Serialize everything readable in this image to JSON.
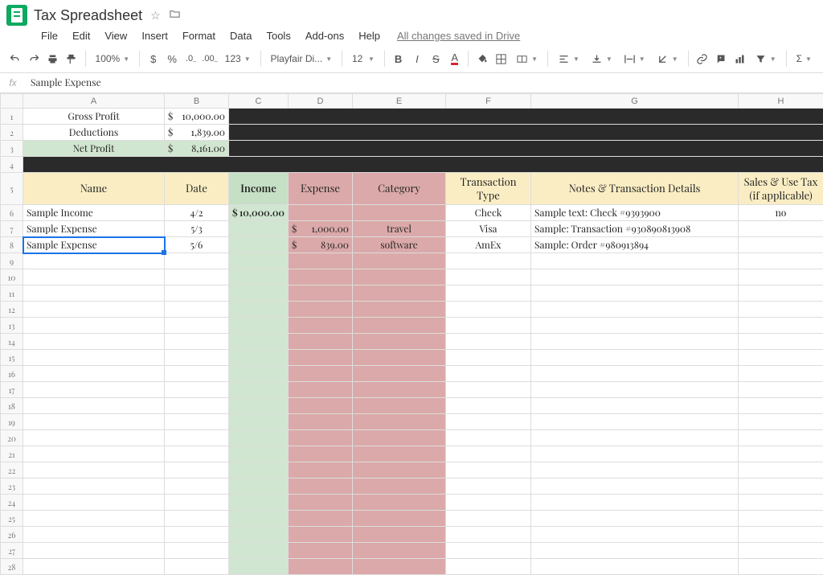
{
  "doc": {
    "title": "Tax Spreadsheet"
  },
  "menu": {
    "file": "File",
    "edit": "Edit",
    "view": "View",
    "insert": "Insert",
    "format": "Format",
    "data": "Data",
    "tools": "Tools",
    "addons": "Add-ons",
    "help": "Help",
    "save": "All changes saved in Drive"
  },
  "toolbar": {
    "zoom": "100%",
    "font": "Playfair Di...",
    "size": "12",
    "numfmt": "123"
  },
  "fx": {
    "label": "fx",
    "value": "Sample Expense"
  },
  "columns": [
    "A",
    "B",
    "C",
    "D",
    "E",
    "F",
    "G",
    "H"
  ],
  "summary": {
    "gross_label": "Gross Profit",
    "gross_val": "10,000.00",
    "ded_label": "Deductions",
    "ded_val": "1,839.00",
    "net_label": "Net Profit",
    "net_val": "8,161.00"
  },
  "headers": {
    "name": "Name",
    "date": "Date",
    "income": "Income",
    "expense": "Expense",
    "category": "Category",
    "txn": "Transaction Type",
    "notes": "Notes & Transaction Details",
    "tax": "Sales & Use Tax (if applicable)"
  },
  "rows": [
    {
      "name": "Sample Income",
      "date": "4/2",
      "income": "10,000.00",
      "expense": "",
      "category": "",
      "txn": "Check",
      "notes": "Sample text: Check #9393900",
      "tax": "no"
    },
    {
      "name": "Sample Expense",
      "date": "5/3",
      "income": "",
      "expense": "1,000.00",
      "category": "travel",
      "txn": "Visa",
      "notes": "Sample: Transaction #930890813908",
      "tax": ""
    },
    {
      "name": "Sample Expense",
      "date": "5/6",
      "income": "",
      "expense": "839.00",
      "category": "software",
      "txn": "AmEx",
      "notes": "Sample: Order #980913894",
      "tax": ""
    }
  ],
  "currency": "$"
}
